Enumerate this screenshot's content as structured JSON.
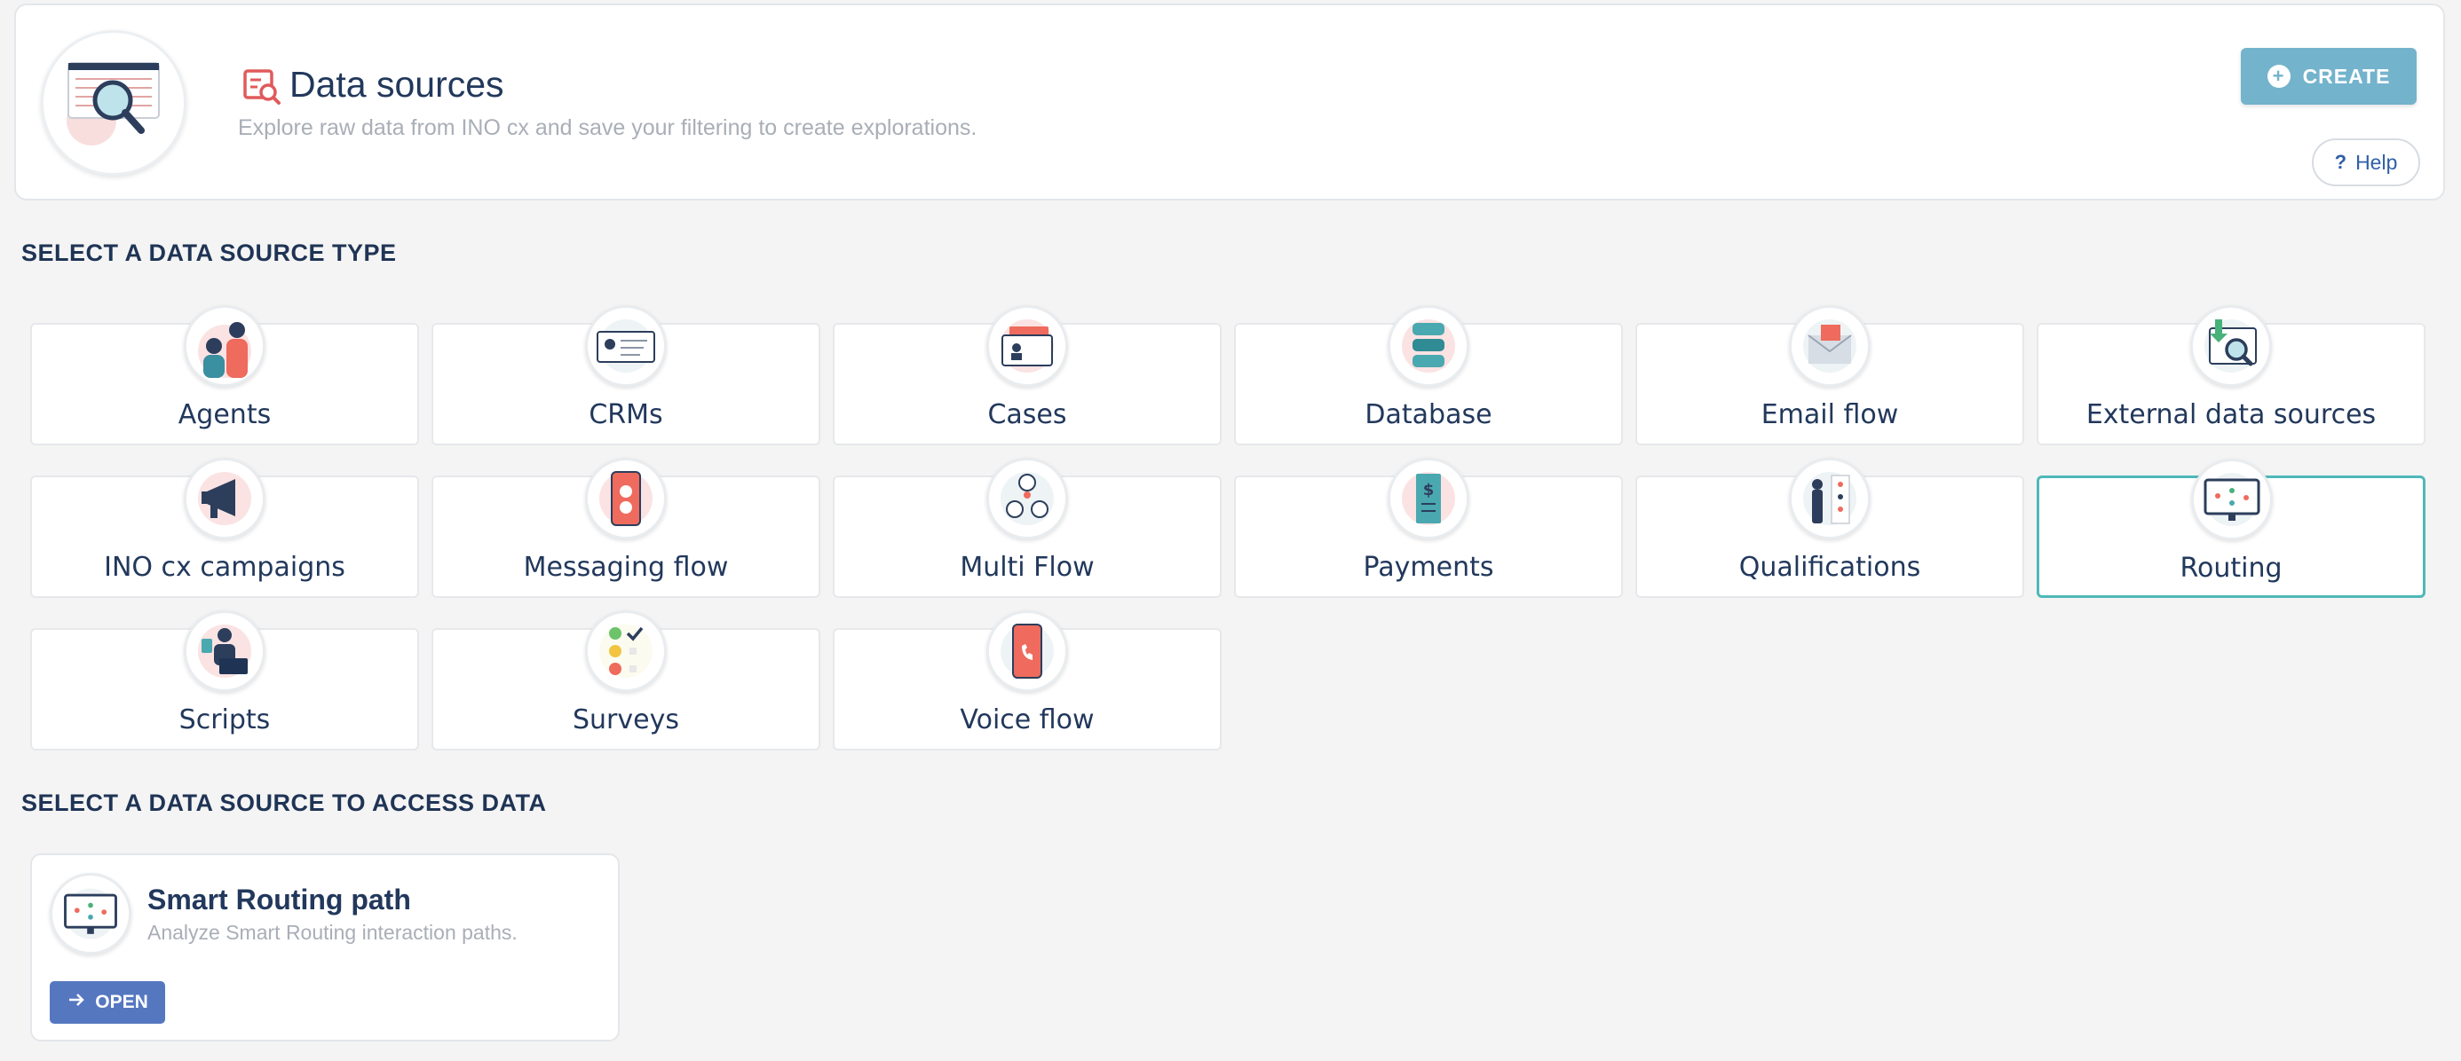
{
  "header": {
    "title": "Data sources",
    "subtitle": "Explore raw data from INO cx and save your filtering to create explorations.",
    "create_label": "CREATE",
    "help_label": "Help",
    "help_symbol": "?"
  },
  "sections": {
    "types_heading": "SELECT A DATA SOURCE TYPE",
    "access_heading": "SELECT A DATA SOURCE TO ACCESS DATA"
  },
  "types": [
    {
      "label": "Agents",
      "icon": "agents-icon"
    },
    {
      "label": "CRMs",
      "icon": "crm-card-icon"
    },
    {
      "label": "Cases",
      "icon": "cases-icon"
    },
    {
      "label": "Database",
      "icon": "database-icon"
    },
    {
      "label": "Email flow",
      "icon": "email-icon"
    },
    {
      "label": "External data sources",
      "icon": "external-search-icon"
    },
    {
      "label": "INO cx campaigns",
      "icon": "megaphone-icon"
    },
    {
      "label": "Messaging flow",
      "icon": "phone-chat-icon"
    },
    {
      "label": "Multi Flow",
      "icon": "multi-channel-icon"
    },
    {
      "label": "Payments",
      "icon": "receipt-dollar-icon"
    },
    {
      "label": "Qualifications",
      "icon": "qualifications-icon"
    },
    {
      "label": "Routing",
      "icon": "routing-monitor-icon",
      "selected": true
    },
    {
      "label": "Scripts",
      "icon": "scripts-person-icon"
    },
    {
      "label": "Surveys",
      "icon": "survey-checklist-icon"
    },
    {
      "label": "Voice flow",
      "icon": "voice-phone-icon"
    }
  ],
  "source": {
    "title": "Smart Routing path",
    "description": "Analyze Smart Routing interaction paths.",
    "open_label": "OPEN"
  },
  "colors": {
    "accent_create": "#73b3cc",
    "accent_open": "#5577c0",
    "selected_border": "#4fb8b8",
    "title_text": "#22385c"
  }
}
